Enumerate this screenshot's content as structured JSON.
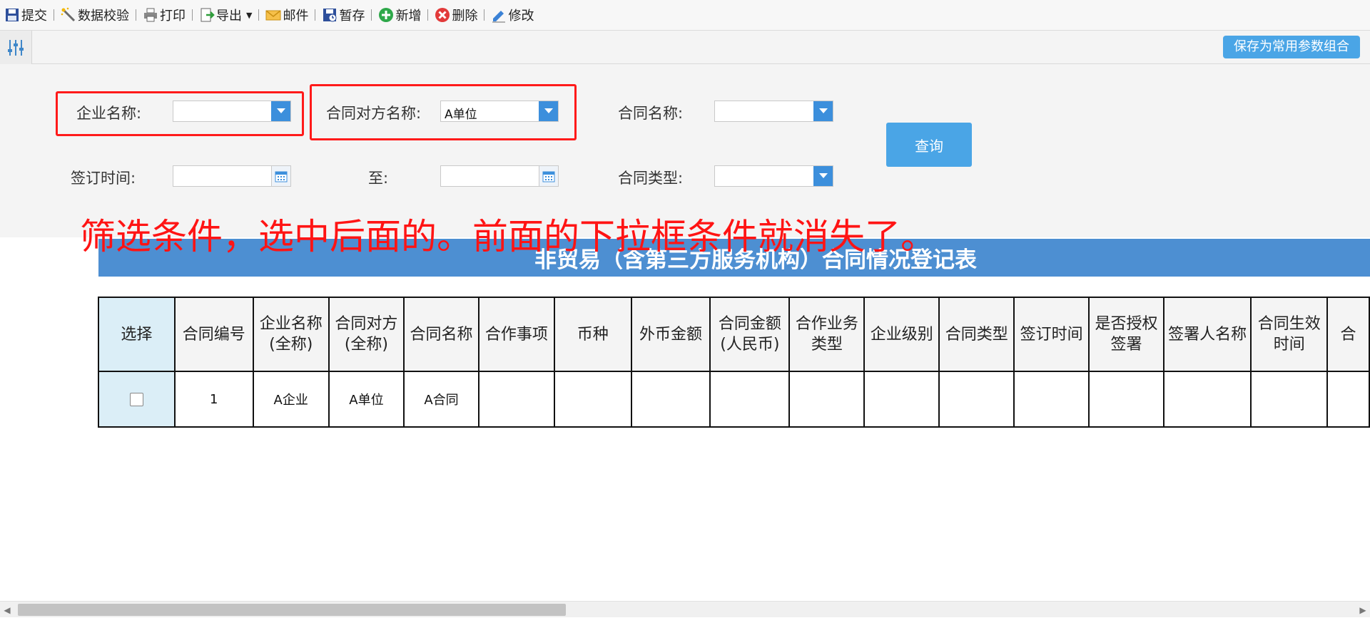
{
  "toolbar": {
    "items": [
      {
        "label": "提交",
        "icon": "save-icon"
      },
      {
        "label": "数据校验",
        "icon": "magic-wand-icon"
      },
      {
        "label": "打印",
        "icon": "printer-icon"
      },
      {
        "label": "导出",
        "icon": "export-icon"
      },
      {
        "label": "邮件",
        "icon": "mail-icon"
      },
      {
        "label": "暂存",
        "icon": "temp-save-icon"
      },
      {
        "label": "新增",
        "icon": "add-icon"
      },
      {
        "label": "删除",
        "icon": "delete-icon"
      },
      {
        "label": "修改",
        "icon": "edit-icon"
      }
    ]
  },
  "settings_bar": {
    "save_combo_label": "保存为常用参数组合"
  },
  "filters": {
    "company_label": "企业名称:",
    "company_value": "",
    "counterparty_label": "合同对方名称:",
    "counterparty_value": "A单位",
    "contract_name_label": "合同名称:",
    "contract_name_value": "",
    "sign_time_label": "签订时间:",
    "sign_from": "",
    "to_label": "至:",
    "sign_to": "",
    "contract_type_label": "合同类型:",
    "contract_type_value": "",
    "search_label": "查询"
  },
  "annotation": "筛选条件，选中后面的。前面的下拉框条件就消失了。",
  "table": {
    "title": "非贸易（含第三方服务机构）合同情况登记表",
    "headers": [
      [
        "选择"
      ],
      [
        "合同编号"
      ],
      [
        "企业名称",
        "(全称)"
      ],
      [
        "合同对方",
        "(全称)"
      ],
      [
        "合同名称"
      ],
      [
        "合作事项"
      ],
      [
        "币种"
      ],
      [
        "外币金额"
      ],
      [
        "合同金额",
        "(人民币)"
      ],
      [
        "合作业务",
        "类型"
      ],
      [
        "企业级别"
      ],
      [
        "合同类型"
      ],
      [
        "签订时间"
      ],
      [
        "是否授权",
        "签署"
      ],
      [
        "签署人名称"
      ],
      [
        "合同生效",
        "时间"
      ],
      [
        "合"
      ]
    ],
    "rows": [
      [
        "",
        "1",
        "A企业",
        "A单位",
        "A合同",
        "",
        "",
        "",
        "",
        "",
        "",
        "",
        "",
        "",
        "",
        "",
        ""
      ]
    ]
  },
  "colors": {
    "accent": "#4aa5e6",
    "dropdown_arrow": "#3c8fdc",
    "title_bar": "#4d8fd2",
    "annotation": "#ff1414",
    "highlight_box": "#ff1a1a",
    "select_column": "#dbeef7"
  }
}
